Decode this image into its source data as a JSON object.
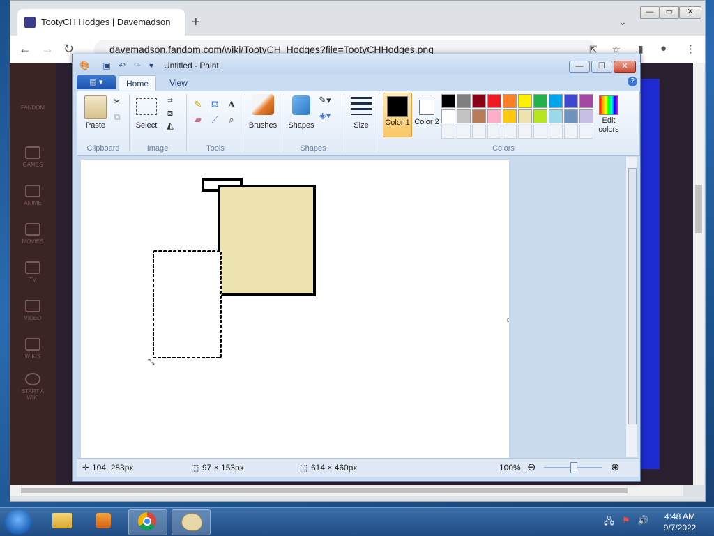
{
  "browser": {
    "tab_title": "TootyCH Hodges | Davemadson",
    "new_tab_icon": "+",
    "url": "davemadson.fandom.com/wiki/TootyCH_Hodges?file=TootyCHHodges.png",
    "fandom_sidebar": [
      "FANDOM",
      "GAMES",
      "ANIME",
      "MOVIES",
      "TV",
      "VIDEO",
      "WIKIS",
      "START A WIKI"
    ]
  },
  "paint": {
    "title": "Untitled - Paint",
    "tabs": {
      "file": "▤ ▾",
      "home": "Home",
      "view": "View"
    },
    "groups": {
      "clipboard": "Clipboard",
      "image": "Image",
      "tools": "Tools",
      "shapes": "Shapes",
      "colors": "Colors"
    },
    "buttons": {
      "paste": "Paste",
      "select": "Select",
      "brushes": "Brushes",
      "shapes": "Shapes",
      "size": "Size",
      "color1": "Color 1",
      "color2": "Color 2",
      "edit_colors": "Edit colors"
    },
    "palette": [
      "#000000",
      "#7f7f7f",
      "#880015",
      "#ed1c24",
      "#ff7f27",
      "#fff200",
      "#22b14c",
      "#00a2e8",
      "#3f48cc",
      "#a349a4",
      "#ffffff",
      "#c3c3c3",
      "#b97a57",
      "#ffaec9",
      "#ffc90e",
      "#efe4b0",
      "#b5e61d",
      "#99d9ea",
      "#7092be",
      "#c8bfe7"
    ],
    "color1": "#000000",
    "color2": "#ffffff",
    "shape_fill": "#ede4af",
    "status": {
      "cursor": "104, 283px",
      "selection": "97 × 153px",
      "canvas": "614 × 460px",
      "zoom": "100%"
    }
  },
  "taskbar": {
    "time": "4:48 AM",
    "date": "9/7/2022"
  }
}
